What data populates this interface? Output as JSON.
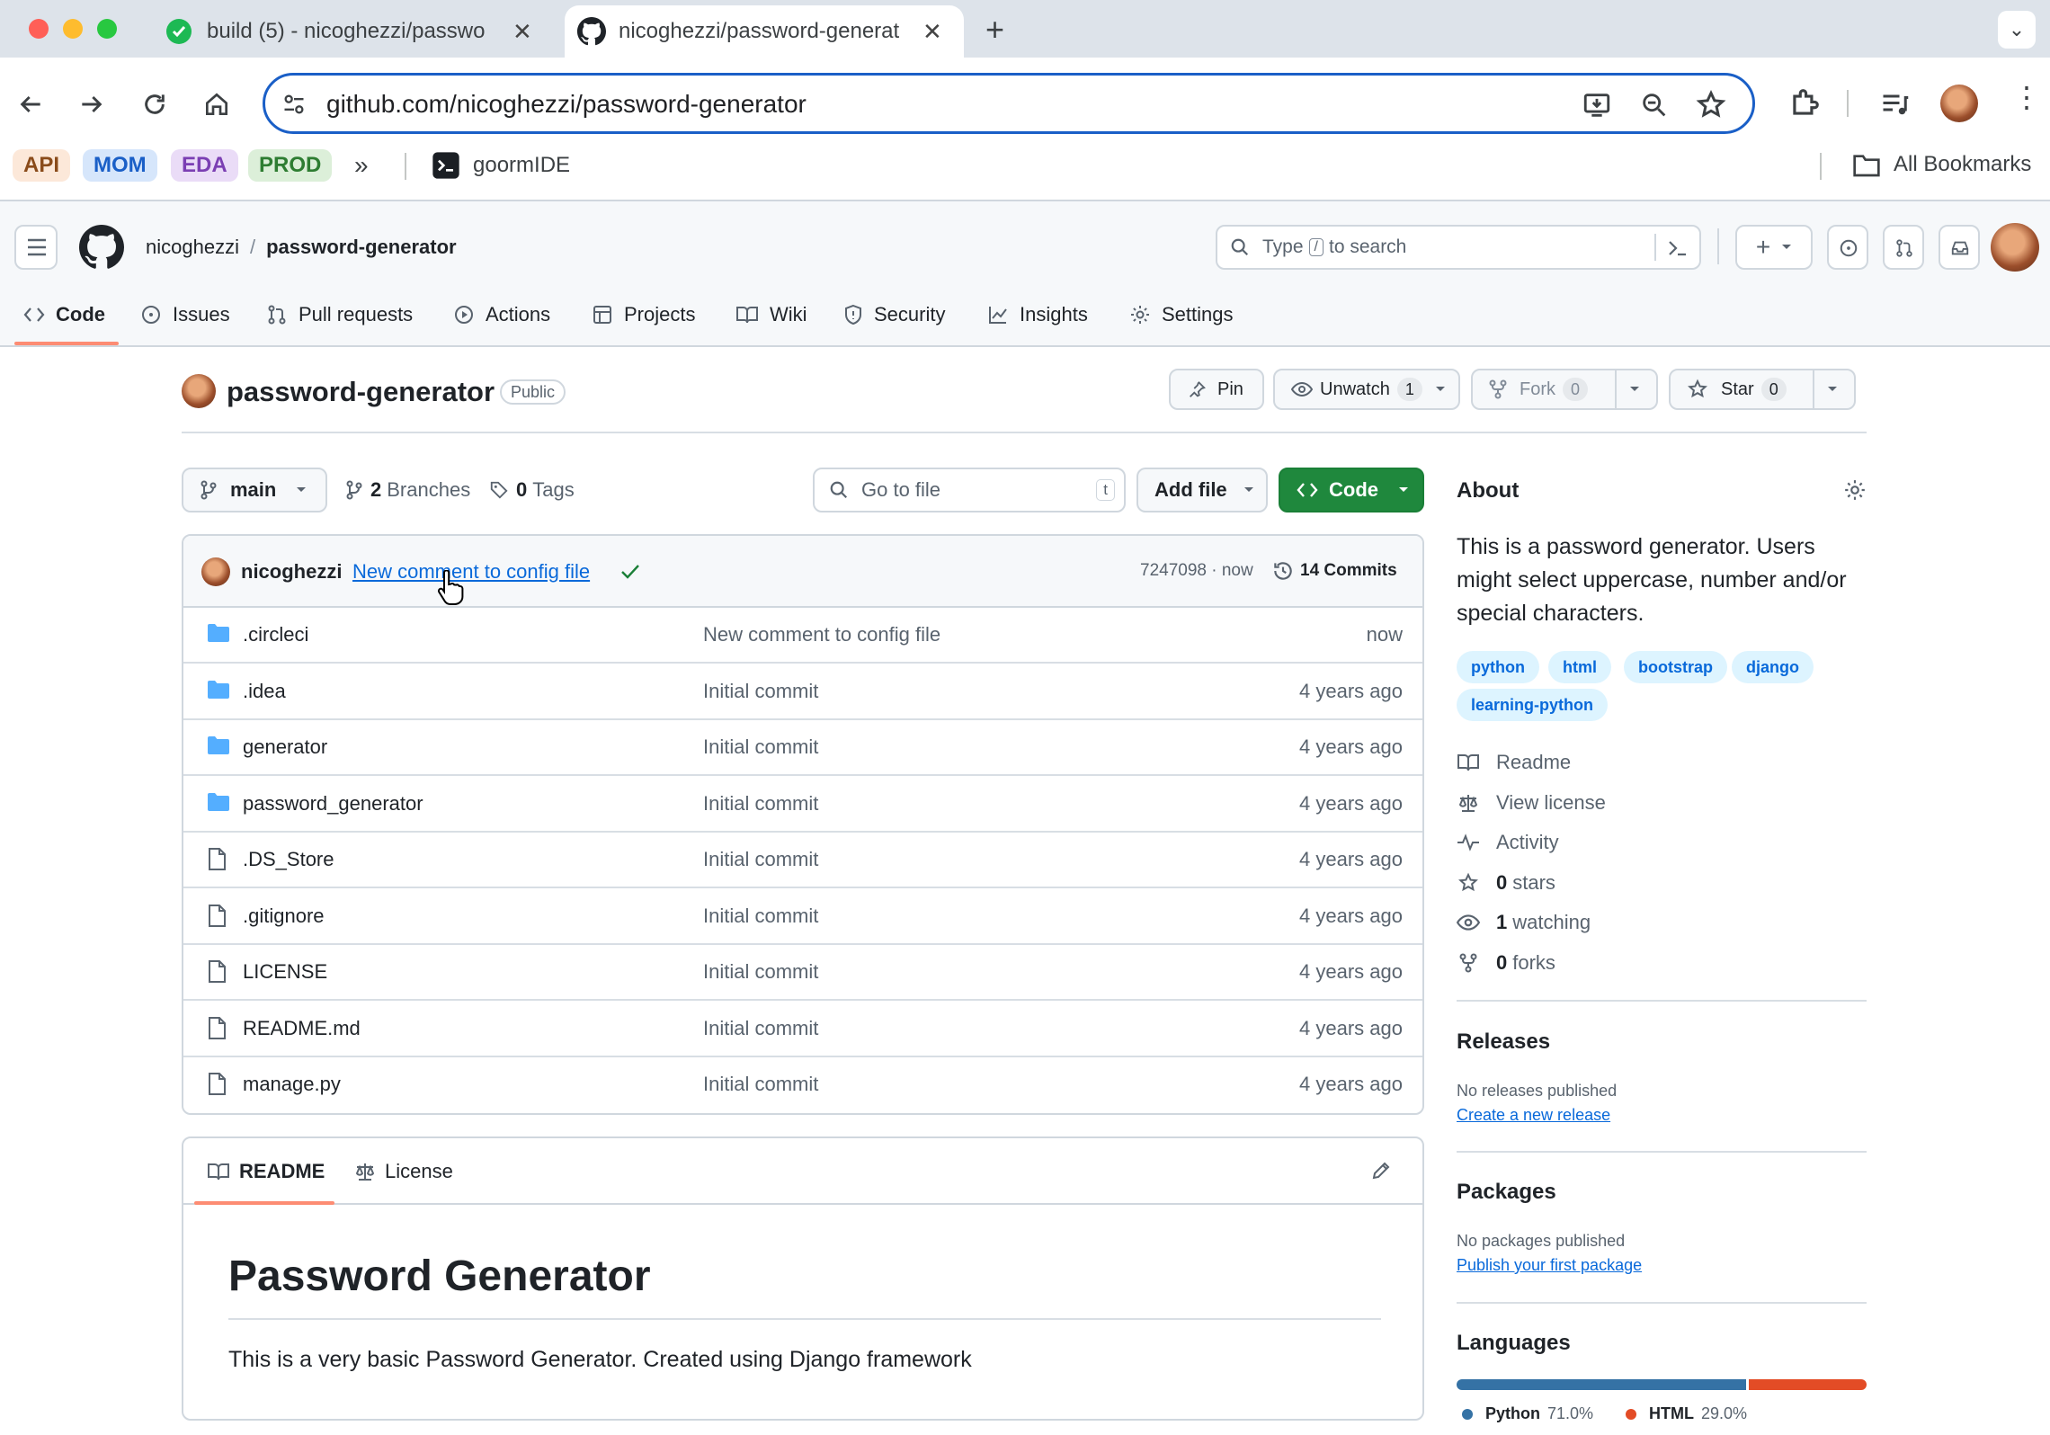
{
  "browser": {
    "tabs": [
      {
        "title": "build (5) - nicoghezzi/passwo",
        "active": false
      },
      {
        "title": "nicoghezzi/password-generat",
        "active": true
      }
    ],
    "url": "github.com/nicoghezzi/password-generator",
    "bookmarks": [
      {
        "label": "API",
        "bg": "#fce8d9",
        "fg": "#8a4b1a"
      },
      {
        "label": "MOM",
        "bg": "#d6e6fb",
        "fg": "#1a5fc7"
      },
      {
        "label": "EDA",
        "bg": "#eadcf7",
        "fg": "#7b3fb3"
      },
      {
        "label": "PROD",
        "bg": "#dcefd9",
        "fg": "#2e7d32"
      }
    ],
    "bookmark_goorm": "goormIDE",
    "all_bookmarks": "All Bookmarks"
  },
  "header": {
    "owner": "nicoghezzi",
    "separator": "/",
    "repo": "password-generator",
    "search_type": "Type",
    "search_key": "/",
    "search_rest": "to search"
  },
  "nav": {
    "items": [
      "Code",
      "Issues",
      "Pull requests",
      "Actions",
      "Projects",
      "Wiki",
      "Security",
      "Insights",
      "Settings"
    ]
  },
  "repo": {
    "name": "password-generator",
    "visibility": "Public",
    "pin": "Pin",
    "unwatch": "Unwatch",
    "watch_count": "1",
    "fork": "Fork",
    "fork_count": "0",
    "star": "Star",
    "star_count": "0"
  },
  "filebar": {
    "branch": "main",
    "branches_count": "2",
    "branches_label": "Branches",
    "tags_count": "0",
    "tags_label": "Tags",
    "goto_placeholder": "Go to file",
    "goto_key": "t",
    "add_file": "Add file",
    "code": "Code"
  },
  "commit": {
    "author": "nicoghezzi",
    "message": "New comment to config file",
    "hash_time": "7247098 · now",
    "commits": "14 Commits"
  },
  "files": [
    {
      "name": ".circleci",
      "type": "dir",
      "message": "New comment to config file",
      "time": "now"
    },
    {
      "name": ".idea",
      "type": "dir",
      "message": "Initial commit",
      "time": "4 years ago"
    },
    {
      "name": "generator",
      "type": "dir",
      "message": "Initial commit",
      "time": "4 years ago"
    },
    {
      "name": "password_generator",
      "type": "dir",
      "message": "Initial commit",
      "time": "4 years ago"
    },
    {
      "name": ".DS_Store",
      "type": "file",
      "message": "Initial commit",
      "time": "4 years ago"
    },
    {
      "name": ".gitignore",
      "type": "file",
      "message": "Initial commit",
      "time": "4 years ago"
    },
    {
      "name": "LICENSE",
      "type": "file",
      "message": "Initial commit",
      "time": "4 years ago"
    },
    {
      "name": "README.md",
      "type": "file",
      "message": "Initial commit",
      "time": "4 years ago"
    },
    {
      "name": "manage.py",
      "type": "file",
      "message": "Initial commit",
      "time": "4 years ago"
    }
  ],
  "readme": {
    "tab_readme": "README",
    "tab_license": "License",
    "title": "Password Generator",
    "body": "This is a very basic Password Generator. Created using Django framework"
  },
  "about": {
    "heading": "About",
    "description": "This is a password generator. Users might select uppercase, number and/or special characters.",
    "topics": [
      "python",
      "html",
      "bootstrap",
      "django",
      "learning-python"
    ],
    "readme": "Readme",
    "license": "View license",
    "activity": "Activity",
    "stars_count": "0",
    "stars_label": "stars",
    "watching_count": "1",
    "watching_label": "watching",
    "forks_count": "0",
    "forks_label": "forks"
  },
  "releases": {
    "heading": "Releases",
    "empty": "No releases published",
    "link": "Create a new release"
  },
  "packages": {
    "heading": "Packages",
    "empty": "No packages published",
    "link": "Publish your first package"
  },
  "languages": {
    "heading": "Languages",
    "items": [
      {
        "name": "Python",
        "percent": "71.0%",
        "value": 71.0,
        "color": "#3572A5"
      },
      {
        "name": "HTML",
        "percent": "29.0%",
        "value": 29.0,
        "color": "#e34c26"
      }
    ]
  }
}
